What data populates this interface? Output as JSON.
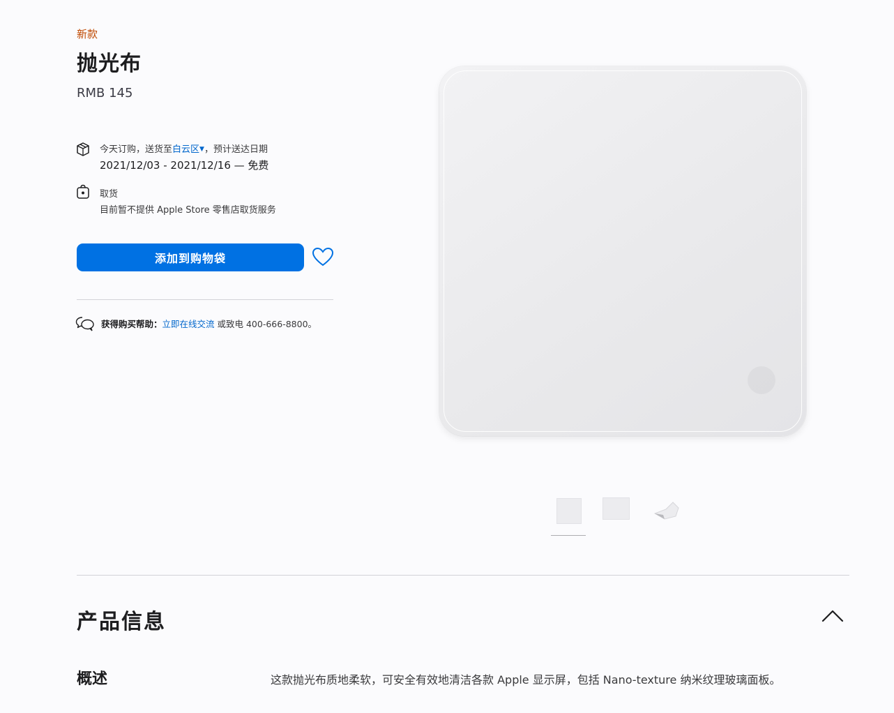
{
  "product": {
    "badge": "新款",
    "title": "抛光布",
    "price": "RMB 145"
  },
  "delivery": {
    "icon": "box-icon",
    "line1_prefix": "今天订购，送货至",
    "location": "白云区",
    "line1_suffix": "，预计送达日期",
    "dates": "2021/12/03 - 2021/12/16 — 免费"
  },
  "pickup": {
    "icon": "store-bag-icon",
    "label": "取货",
    "note": "目前暂不提供 Apple Store 零售店取货服务"
  },
  "actions": {
    "add_to_bag": "添加到购物袋",
    "favorite_icon": "heart-icon"
  },
  "help": {
    "icon": "chat-icon",
    "strong": "获得购买帮助：",
    "link": "立即在线交流",
    "rest": " 或致电 400-666-8800。"
  },
  "gallery": {
    "thumbnails": [
      "thumbnail-front",
      "thumbnail-back",
      "thumbnail-folded"
    ]
  },
  "info": {
    "section_title": "产品信息",
    "overview_label": "概述",
    "overview_text": "这款抛光布质地柔软，可安全有效地清洁各款 Apple 显示屏，包括 Nano-texture 纳米纹理玻璃面板。"
  },
  "colors": {
    "accent": "#0071e3",
    "link": "#0066cc",
    "badge": "#bf4800"
  }
}
